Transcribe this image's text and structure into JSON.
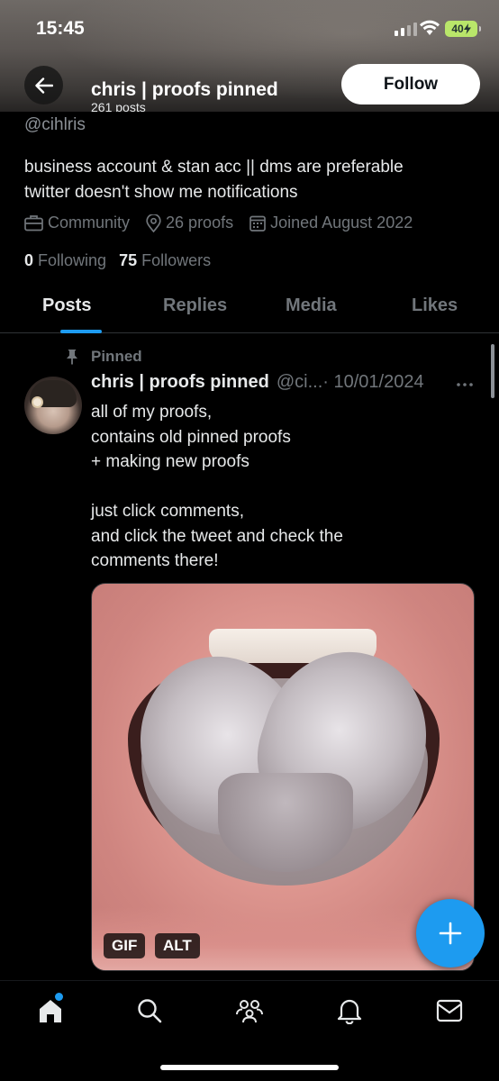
{
  "status_bar": {
    "time": "15:45",
    "battery": "40"
  },
  "header": {
    "name": "chris | proofs pinned",
    "post_count": "261 posts",
    "follow_label": "Follow"
  },
  "profile": {
    "handle": "@cihlris",
    "bio_lines": [
      "business account & stan acc || dms are preferable",
      "twitter doesn't show me notifications"
    ],
    "category": "Community",
    "location": "26 proofs",
    "joined": "Joined August 2022",
    "following_count": "0",
    "following_label": "Following",
    "followers_count": "75",
    "followers_label": "Followers"
  },
  "tabs": [
    {
      "label": "Posts",
      "active": true
    },
    {
      "label": "Replies",
      "active": false
    },
    {
      "label": "Media",
      "active": false
    },
    {
      "label": "Likes",
      "active": false
    }
  ],
  "post": {
    "pinned_label": "Pinned",
    "author_name": "chris | proofs pinned",
    "author_handle": "@ci...",
    "date": "· 10/01/2024",
    "more_icon": "more-icon",
    "text_lines": [
      "all of my proofs,",
      "contains old pinned proofs",
      "+ making new proofs",
      "",
      "just click comments,",
      "and click the tweet and check the",
      "comments there!"
    ],
    "media_badges": [
      "GIF",
      "ALT"
    ]
  },
  "colors": {
    "accent": "#1d9bf0",
    "background": "#000000",
    "muted": "#71767b",
    "text": "#e7e9ea"
  },
  "bottom_nav": [
    "home-icon",
    "search-icon",
    "communities-icon",
    "notifications-icon",
    "messages-icon"
  ]
}
